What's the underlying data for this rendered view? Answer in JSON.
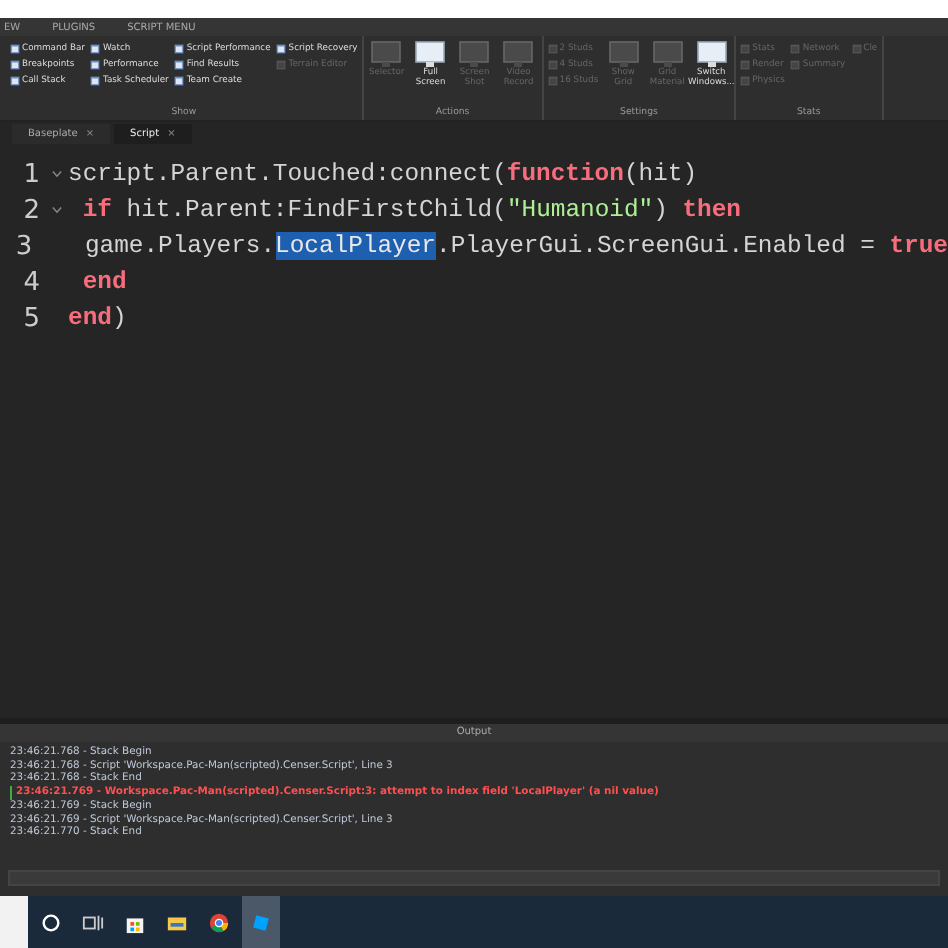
{
  "menu": [
    {
      "label": "EW",
      "selected": false
    },
    {
      "label": "PLUGINS",
      "selected": false
    },
    {
      "label": "SCRIPT MENU",
      "selected": false
    }
  ],
  "ribbon": {
    "groups": [
      {
        "label": "Show",
        "kind": "small",
        "columns": [
          [
            {
              "label": "Command Bar",
              "disabled": false
            },
            {
              "label": "Breakpoints",
              "disabled": false
            },
            {
              "label": "Call Stack",
              "disabled": false
            }
          ],
          [
            {
              "label": "Watch",
              "disabled": false
            },
            {
              "label": "Performance",
              "disabled": false
            },
            {
              "label": "Task Scheduler",
              "disabled": false
            }
          ],
          [
            {
              "label": "Script Performance",
              "disabled": false
            },
            {
              "label": "Find Results",
              "disabled": false
            },
            {
              "label": "Team Create",
              "disabled": false
            }
          ],
          [
            {
              "label": "Script Recovery",
              "disabled": false
            },
            {
              "label": "Terrain Editor",
              "disabled": true
            }
          ]
        ]
      },
      {
        "label": "Actions",
        "kind": "large",
        "items": [
          {
            "label": "Selector",
            "disabled": true
          },
          {
            "label": "Full Screen",
            "disabled": false
          },
          {
            "label": "Screen Shot",
            "disabled": true
          },
          {
            "label": "Video Record",
            "disabled": true
          }
        ]
      },
      {
        "label": "Settings",
        "kind": "mixed",
        "columns": [
          [
            {
              "label": "2 Studs",
              "disabled": true
            },
            {
              "label": "4 Studs",
              "disabled": true
            },
            {
              "label": "16 Studs",
              "disabled": true
            }
          ]
        ],
        "items": [
          {
            "label": "Show Grid",
            "disabled": true
          },
          {
            "label": "Grid Material",
            "disabled": true
          },
          {
            "label": "Switch Windows...",
            "disabled": false
          }
        ]
      },
      {
        "label": "Stats",
        "kind": "small",
        "columns": [
          [
            {
              "label": "Stats",
              "disabled": true
            },
            {
              "label": "Render",
              "disabled": true
            },
            {
              "label": "Physics",
              "disabled": true
            }
          ],
          [
            {
              "label": "Network",
              "disabled": true
            },
            {
              "label": "Summary",
              "disabled": true
            }
          ],
          [
            {
              "label": "Cle",
              "disabled": true
            }
          ]
        ]
      }
    ]
  },
  "tabs": [
    {
      "label": "Baseplate",
      "close": "×",
      "selected": false
    },
    {
      "label": "Script",
      "close": "×",
      "selected": true
    }
  ],
  "editor": {
    "lines": [
      {
        "number": "1",
        "fold": true,
        "tokens": [
          {
            "kind": "text",
            "text": "script.Parent.Touched:connect("
          },
          {
            "kind": "keyword",
            "text": "function"
          },
          {
            "kind": "text",
            "text": "(hit)"
          }
        ]
      },
      {
        "number": "2",
        "fold": true,
        "tokens": [
          {
            "kind": "keyword",
            "text": " if"
          },
          {
            "kind": "text",
            "text": " hit.Parent:FindFirstChild("
          },
          {
            "kind": "string",
            "text": "\"Humanoid\""
          },
          {
            "kind": "text",
            "text": ") "
          },
          {
            "kind": "keyword",
            "text": "then"
          }
        ]
      },
      {
        "number": "3",
        "fold": false,
        "tokens": [
          {
            "kind": "text",
            "text": "  game.Players."
          },
          {
            "kind": "selected",
            "text": "LocalPlayer"
          },
          {
            "kind": "text",
            "text": ".PlayerGui.ScreenGui.Enabled = "
          },
          {
            "kind": "keyword",
            "text": "true"
          }
        ]
      },
      {
        "number": "4",
        "fold": false,
        "tokens": [
          {
            "kind": "keyword",
            "text": " end"
          }
        ]
      },
      {
        "number": "5",
        "fold": false,
        "tokens": [
          {
            "kind": "keyword",
            "text": "end"
          },
          {
            "kind": "text",
            "text": ")"
          }
        ]
      }
    ]
  },
  "output": {
    "title": "Output",
    "lines": [
      {
        "kind": "info",
        "text": "23:46:21.768 - Stack Begin"
      },
      {
        "kind": "info",
        "text": "23:46:21.768 - Script 'Workspace.Pac-Man(scripted).Censer.Script', Line 3"
      },
      {
        "kind": "info",
        "text": "23:46:21.768 - Stack End"
      },
      {
        "kind": "error",
        "text": "23:46:21.769 - Workspace.Pac-Man(scripted).Censer.Script:3: attempt to index field 'LocalPlayer' (a nil value)"
      },
      {
        "kind": "info",
        "text": "23:46:21.769 - Stack Begin"
      },
      {
        "kind": "info",
        "text": "23:46:21.769 - Script 'Workspace.Pac-Man(scripted).Censer.Script', Line 3"
      },
      {
        "kind": "info",
        "text": "23:46:21.770 - Stack End"
      }
    ]
  },
  "taskbar": {
    "items": [
      {
        "kind": "cortana",
        "selected": false
      },
      {
        "kind": "taskview",
        "selected": false
      },
      {
        "kind": "store",
        "selected": false
      },
      {
        "kind": "explorer",
        "selected": false
      },
      {
        "kind": "chrome",
        "selected": false
      },
      {
        "kind": "studio",
        "selected": true
      }
    ]
  }
}
